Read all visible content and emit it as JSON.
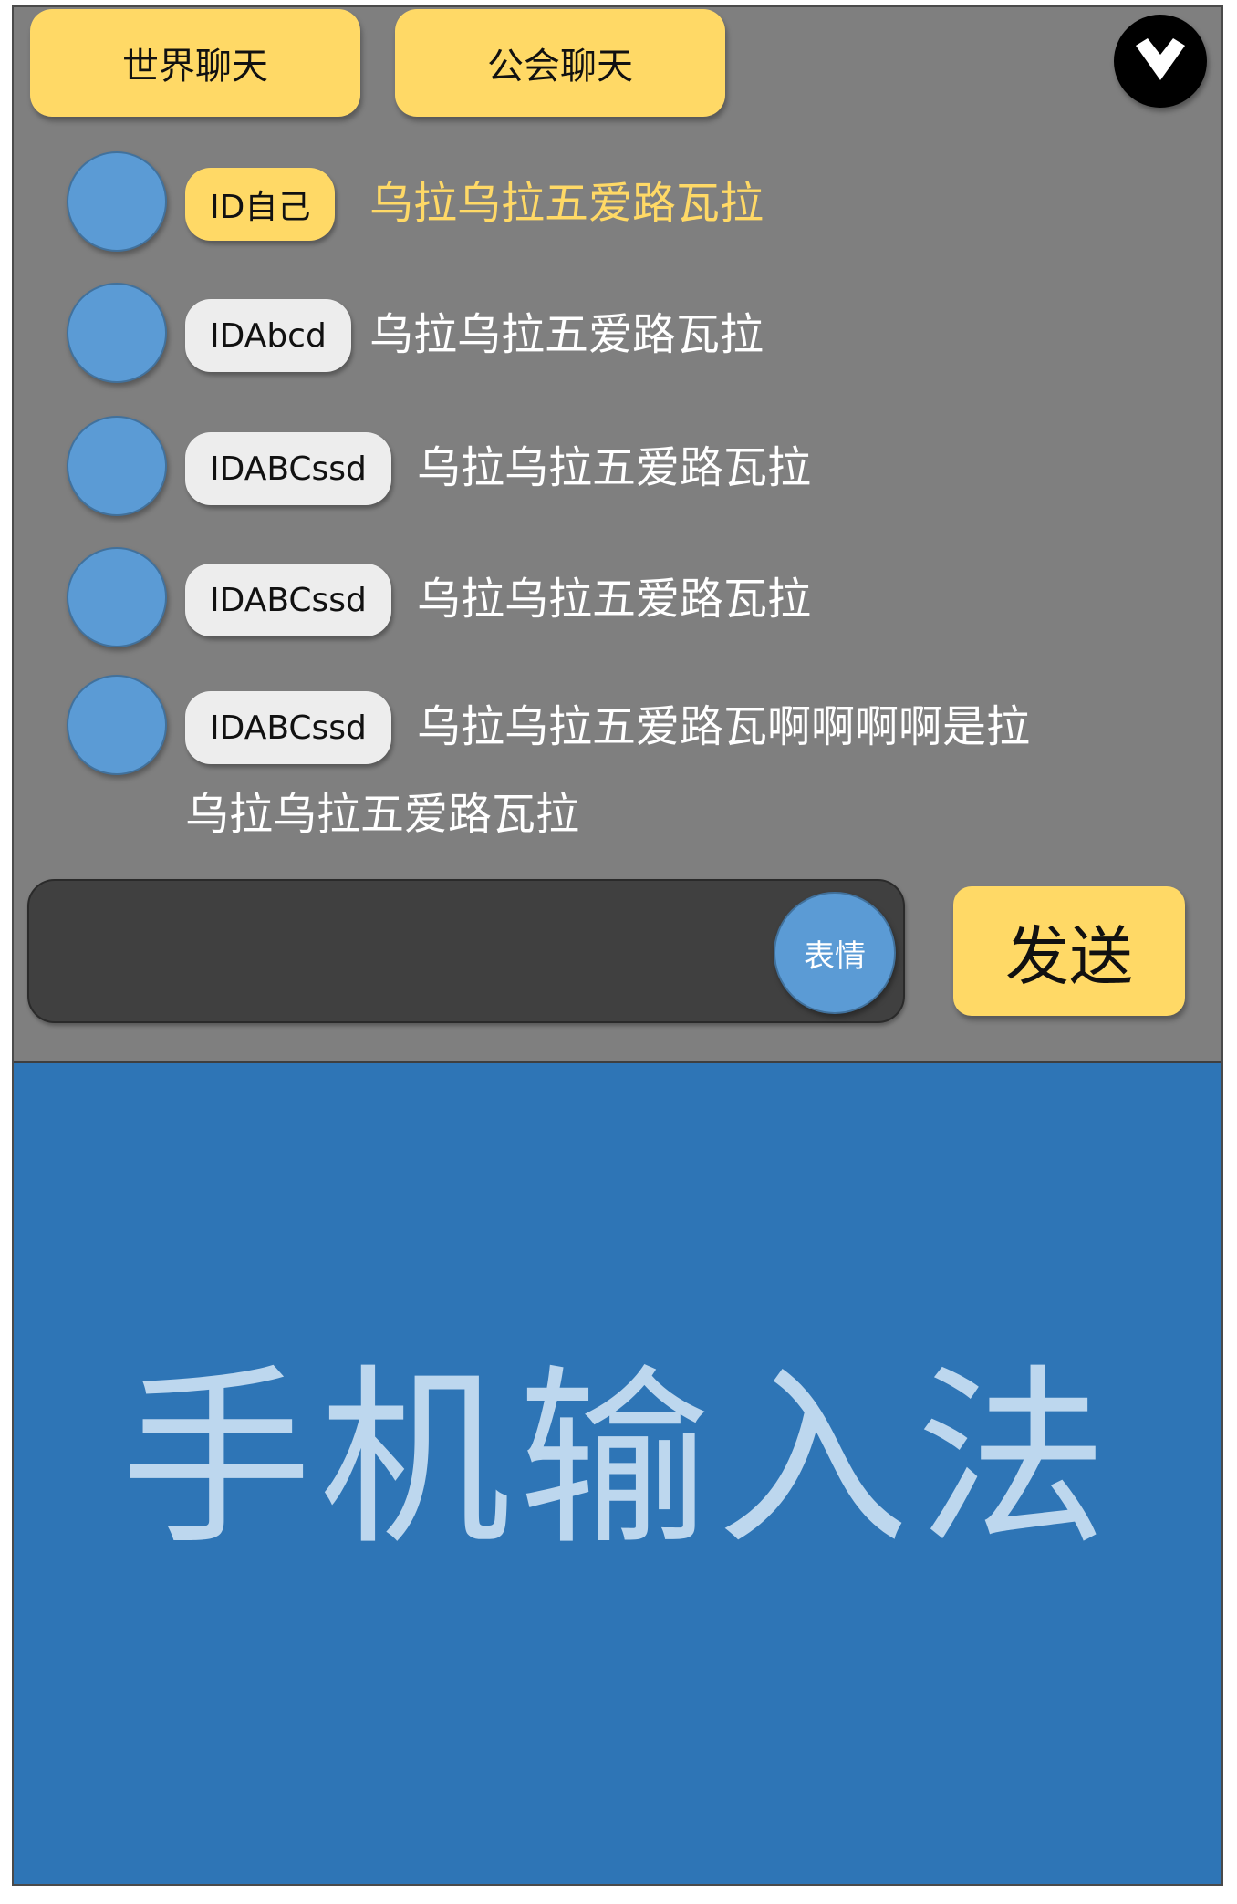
{
  "tabs": {
    "world_chat": "世界聊天",
    "guild_chat": "公会聊天"
  },
  "icons": {
    "collapse": "chevron-down-icon"
  },
  "messages": [
    {
      "id_label": "ID自己",
      "text": "乌拉乌拉五爱路瓦拉",
      "is_self": true
    },
    {
      "id_label": "IDAbcd",
      "text": "乌拉乌拉五爱路瓦拉",
      "is_self": false
    },
    {
      "id_label": "IDABCssd",
      "text": "乌拉乌拉五爱路瓦拉",
      "is_self": false
    },
    {
      "id_label": "IDABCssd",
      "text": "乌拉乌拉五爱路瓦拉",
      "is_self": false
    },
    {
      "id_label": "IDABCssd",
      "text": "乌拉乌拉五爱路瓦啊啊啊啊是拉",
      "text_cont": "乌拉乌拉五爱路瓦拉",
      "is_self": false
    }
  ],
  "input": {
    "value": "",
    "placeholder": "",
    "emoji_label": "表情"
  },
  "send_label": "发送",
  "keyboard": {
    "label": "手机输入法"
  },
  "colors": {
    "panel_bg": "#7f7f7f",
    "accent_yellow": "#ffd966",
    "avatar_blue": "#5b9bd5",
    "keyboard_bg": "#2e75b6",
    "keyboard_text": "#bdd7ee"
  }
}
